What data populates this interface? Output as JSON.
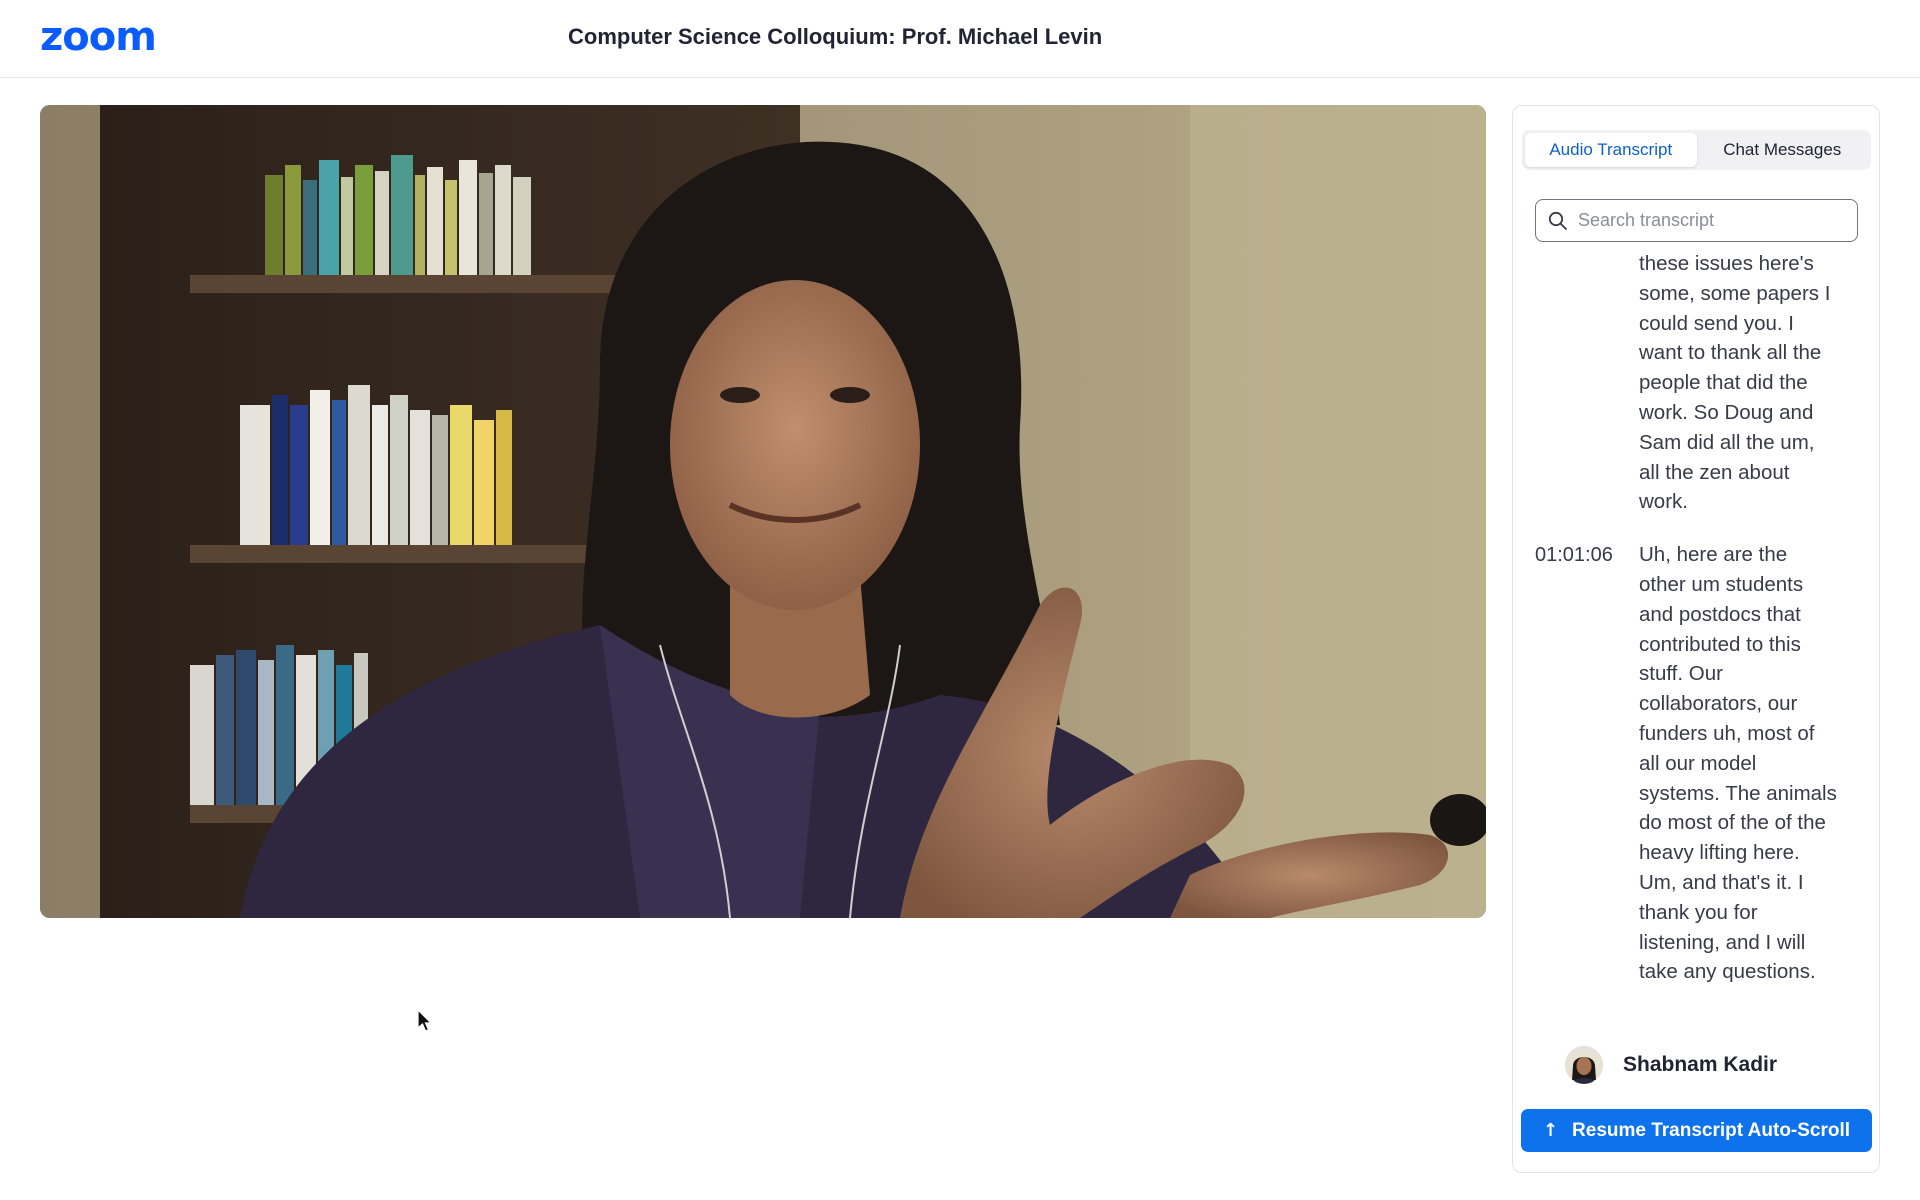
{
  "header": {
    "logo_text": "zoom",
    "title": "Computer Science Colloquium: Prof. Michael Levin"
  },
  "panel": {
    "tabs": [
      {
        "label": "Audio Transcript",
        "active": true
      },
      {
        "label": "Chat Messages",
        "active": false
      }
    ],
    "search": {
      "placeholder": "Search transcript",
      "icon": "search-icon"
    },
    "transcript": [
      {
        "time": "",
        "text": "these issues here's some, some papers I could send you. I want to thank all the people that did the work. So Doug and Sam did all the um, all the zen about work."
      },
      {
        "time": "01:01:06",
        "text": "Uh, here are the other um students and postdocs that contributed to this stuff. Our collaborators, our funders uh, most of all our model systems. The animals do most of the of the heavy lifting here. Um, and that's it. I thank you for listening, and I will take any questions."
      }
    ],
    "speaker": {
      "name": "Shabnam Kadir"
    },
    "resume_button": {
      "label": "Resume Transcript Auto-Scroll",
      "icon": "arrow-up-icon"
    }
  },
  "colors": {
    "brand": "#0b5cff",
    "accent_blue": "#0e72ed",
    "active_tab_text": "#0e5fc9"
  }
}
